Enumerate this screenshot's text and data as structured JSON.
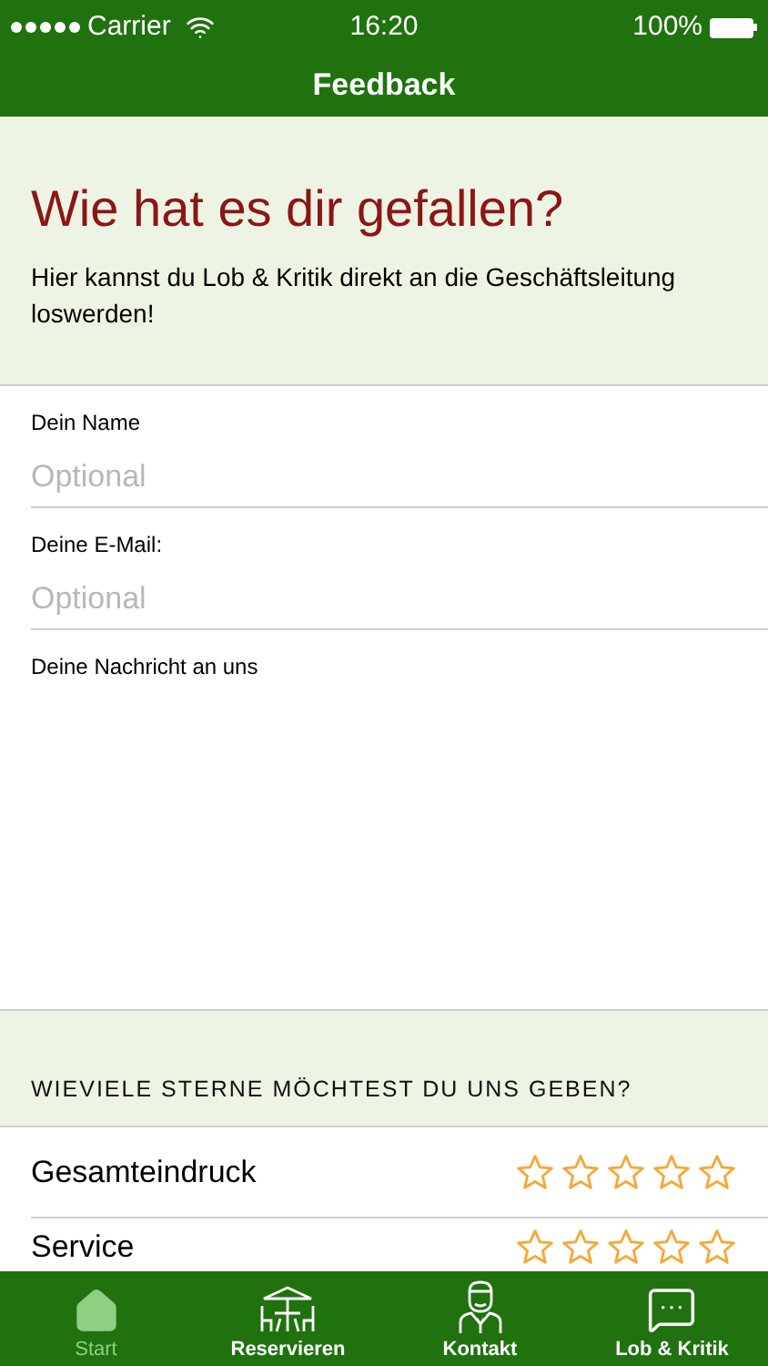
{
  "status_bar": {
    "carrier": "Carrier",
    "time": "16:20",
    "battery": "100%"
  },
  "nav": {
    "title": "Feedback"
  },
  "intro": {
    "title": "Wie hat es dir gefallen?",
    "text": "Hier kannst du Lob & Kritik direkt an die Geschäftsleitung loswerden!"
  },
  "fields": [
    {
      "label": "Dein Name",
      "placeholder": "Optional",
      "kind": "line"
    },
    {
      "label": "Deine E-Mail:",
      "placeholder": "Optional",
      "kind": "line"
    },
    {
      "label": "Deine Nachricht an uns",
      "kind": "area"
    }
  ],
  "ratings_header": "WIEVIELE STERNE MÖCHTEST DU UNS GEBEN?",
  "ratings": [
    {
      "label": "Gesamteindruck",
      "stars": 0
    },
    {
      "label": "Service",
      "stars": 0
    }
  ],
  "tabs": [
    {
      "label": "Start",
      "kind": "home",
      "selected": true
    },
    {
      "label": "Reservieren",
      "kind": "table",
      "selected": false
    },
    {
      "label": "Kontakt",
      "kind": "person",
      "selected": false
    },
    {
      "label": "Lob & Kritik",
      "kind": "chat",
      "selected": false
    }
  ]
}
